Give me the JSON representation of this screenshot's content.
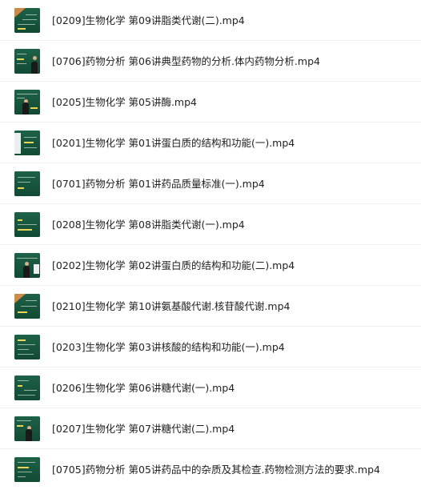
{
  "files": [
    {
      "name": "[0209]生物化学 第09讲脂类代谢(二).mp4",
      "thumb": "tri"
    },
    {
      "name": "[0706]药物分析 第06讲典型药物的分析.体内药物分析.mp4",
      "thumb": "lecture"
    },
    {
      "name": "[0205]生物化学 第05讲酶.mp4",
      "thumb": "lecture"
    },
    {
      "name": "[0201]生物化学 第01讲蛋白质的结构和功能(一).mp4",
      "thumb": "panel"
    },
    {
      "name": "[0701]药物分析 第01讲药品质量标准(一).mp4",
      "thumb": "board"
    },
    {
      "name": "[0208]生物化学 第08讲脂类代谢(一).mp4",
      "thumb": "board"
    },
    {
      "name": "[0202]生物化学 第02讲蛋白质的结构和功能(二).mp4",
      "thumb": "lecture"
    },
    {
      "name": "[0210]生物化学 第10讲氨基酸代谢.核苷酸代谢.mp4",
      "thumb": "tri"
    },
    {
      "name": "[0203]生物化学 第03讲核酸的结构和功能(一).mp4",
      "thumb": "board"
    },
    {
      "name": "[0206]生物化学 第06讲糖代谢(一).mp4",
      "thumb": "board"
    },
    {
      "name": "[0207]生物化学 第07讲糖代谢(二).mp4",
      "thumb": "lecture"
    },
    {
      "name": "[0705]药物分析 第05讲药品中的杂质及其检查.药物检测方法的要求.mp4",
      "thumb": "board"
    }
  ],
  "icon": "video-thumbnail-icon"
}
